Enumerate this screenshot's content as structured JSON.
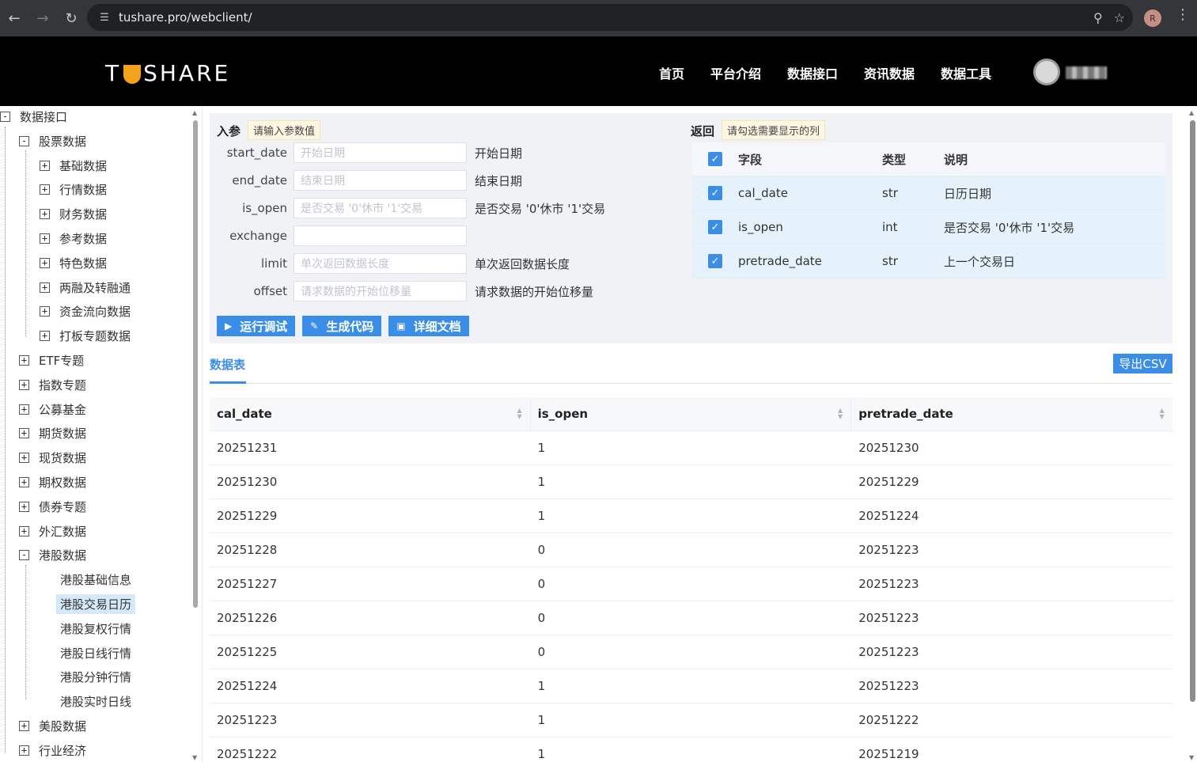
{
  "browser": {
    "url": "tushare.pro/webclient/",
    "profile_initial": "R"
  },
  "site": {
    "logo": "TUSHARE",
    "nav": [
      "首页",
      "平台介绍",
      "数据接口",
      "资讯数据",
      "数据工具"
    ]
  },
  "tree": {
    "root": "数据接口",
    "stock": "股票数据",
    "stock_children": [
      "基础数据",
      "行情数据",
      "财务数据",
      "参考数据",
      "特色数据",
      "两融及转融通",
      "资金流向数据",
      "打板专题数据"
    ],
    "groups": [
      "ETF专题",
      "指数专题",
      "公募基金",
      "期货数据",
      "现货数据",
      "期权数据",
      "债券专题",
      "外汇数据"
    ],
    "hk": "港股数据",
    "hk_children": [
      "港股基础信息",
      "港股交易日历",
      "港股复权行情",
      "港股日线行情",
      "港股分钟行情",
      "港股实时日线"
    ],
    "hk_selected": "港股交易日历",
    "after": [
      "美股数据",
      "行业经济"
    ]
  },
  "params": {
    "title": "入参",
    "hint": "请输入参数值",
    "rows": [
      {
        "name": "start_date",
        "placeholder": "开始日期",
        "desc": "开始日期"
      },
      {
        "name": "end_date",
        "placeholder": "结束日期",
        "desc": "结束日期"
      },
      {
        "name": "is_open",
        "placeholder": "是否交易 '0'休市 '1'交易",
        "desc": "是否交易 '0'休市 '1'交易"
      },
      {
        "name": "exchange",
        "placeholder": "",
        "desc": ""
      },
      {
        "name": "limit",
        "placeholder": "单次返回数据长度",
        "desc": "单次返回数据长度"
      },
      {
        "name": "offset",
        "placeholder": "请求数据的开始位移量",
        "desc": "请求数据的开始位移量"
      }
    ],
    "buttons": {
      "run": "运行调试",
      "gen": "生成代码",
      "doc": "详细文档"
    }
  },
  "returns": {
    "title": "返回",
    "hint": "请勾选需要显示的列",
    "headers": [
      "字段",
      "类型",
      "说明"
    ],
    "rows": [
      {
        "field": "cal_date",
        "type": "str",
        "desc": "日历日期"
      },
      {
        "field": "is_open",
        "type": "int",
        "desc": "是否交易 '0'休市 '1'交易"
      },
      {
        "field": "pretrade_date",
        "type": "str",
        "desc": "上一个交易日"
      }
    ]
  },
  "data_tab": {
    "label": "数据表",
    "export": "导出CSV",
    "columns": [
      "cal_date",
      "is_open",
      "pretrade_date"
    ],
    "rows": [
      [
        "20251231",
        "1",
        "20251230"
      ],
      [
        "20251230",
        "1",
        "20251229"
      ],
      [
        "20251229",
        "1",
        "20251224"
      ],
      [
        "20251228",
        "0",
        "20251223"
      ],
      [
        "20251227",
        "0",
        "20251223"
      ],
      [
        "20251226",
        "0",
        "20251223"
      ],
      [
        "20251225",
        "0",
        "20251223"
      ],
      [
        "20251224",
        "1",
        "20251223"
      ],
      [
        "20251223",
        "1",
        "20251222"
      ],
      [
        "20251222",
        "1",
        "20251219"
      ]
    ]
  },
  "colors": {
    "accent": "#3b8ee8",
    "header_bg": "#000000",
    "logo_accent": "#f2a21b"
  }
}
